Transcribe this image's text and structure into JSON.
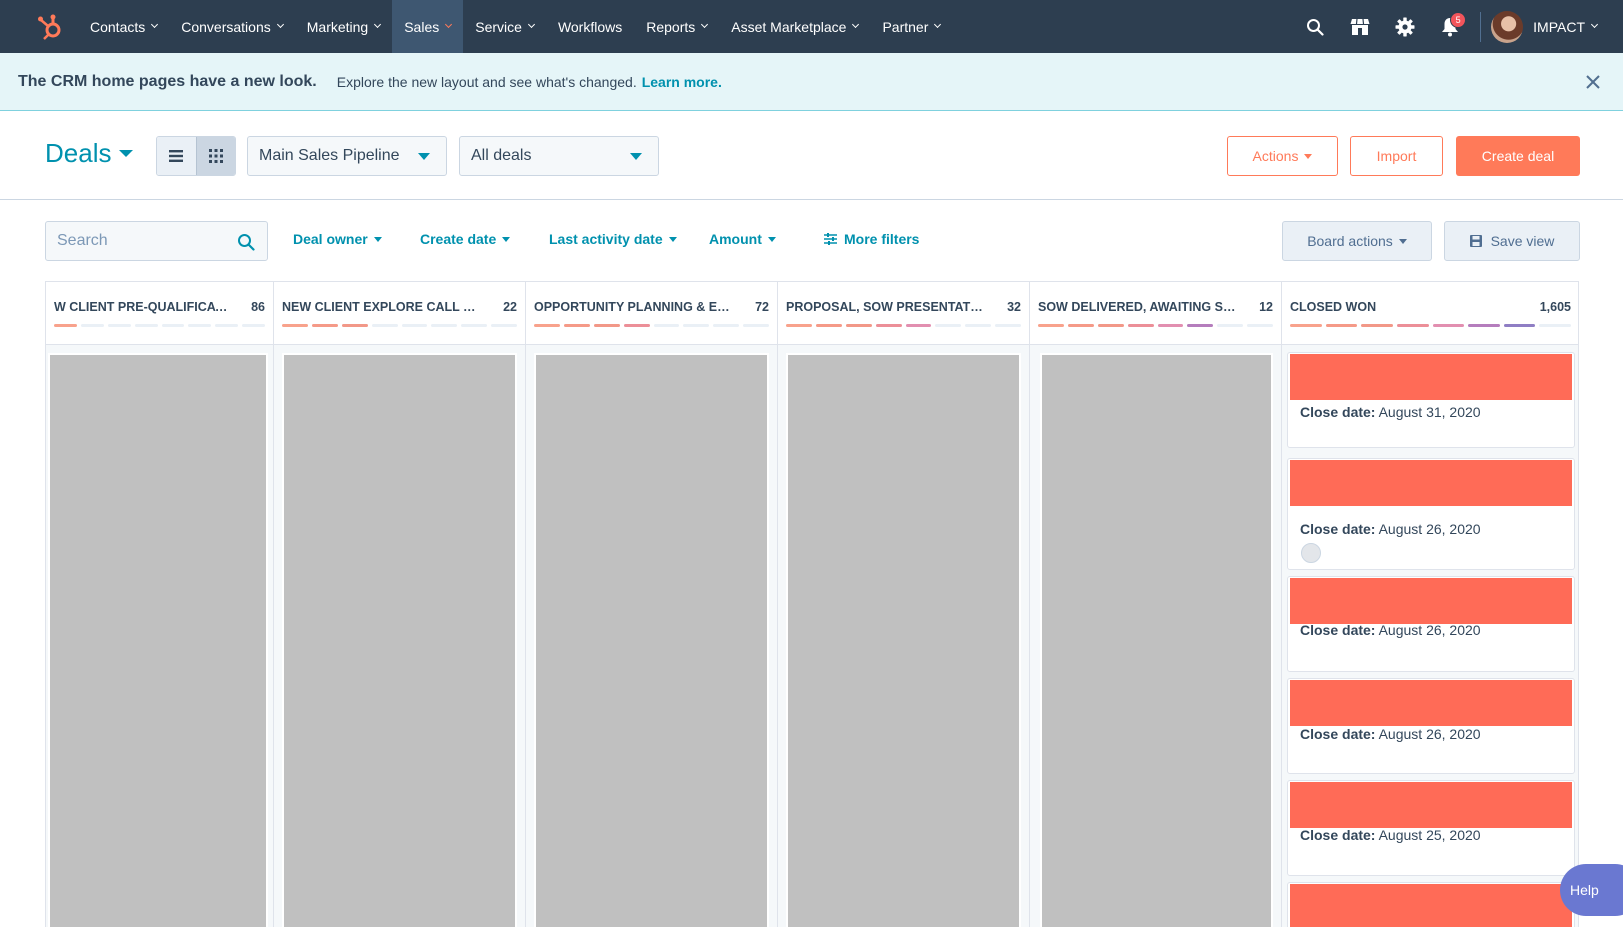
{
  "nav": {
    "items": [
      {
        "label": "Contacts",
        "caret": true,
        "active": false
      },
      {
        "label": "Conversations",
        "caret": true,
        "active": false
      },
      {
        "label": "Marketing",
        "caret": true,
        "active": false
      },
      {
        "label": "Sales",
        "caret": true,
        "active": true
      },
      {
        "label": "Service",
        "caret": true,
        "active": false
      },
      {
        "label": "Workflows",
        "caret": false,
        "active": false
      },
      {
        "label": "Reports",
        "caret": true,
        "active": false
      },
      {
        "label": "Asset Marketplace",
        "caret": true,
        "active": false
      },
      {
        "label": "Partner",
        "caret": true,
        "active": false
      }
    ],
    "notification_count": "5",
    "account_name": "IMPACT"
  },
  "banner": {
    "title": "The CRM home pages have a new look.",
    "text": "Explore the new layout and see what's changed.",
    "link": "Learn more."
  },
  "header": {
    "title": "Deals",
    "pipeline": "Main Sales Pipeline",
    "view": "All deals",
    "actions_label": "Actions",
    "import_label": "Import",
    "create_label": "Create deal"
  },
  "filters": {
    "search_placeholder": "Search",
    "deal_owner": "Deal owner",
    "create_date": "Create date",
    "last_activity": "Last activity date",
    "amount": "Amount",
    "more_filters": "More filters",
    "board_actions": "Board actions",
    "save_view": "Save view"
  },
  "columns": [
    {
      "name": "W CLIENT PRE-QUALIFICATION",
      "count": "86",
      "filled_segments": 1
    },
    {
      "name": "NEW CLIENT EXPLORE CALL SCHEDU...",
      "count": "22",
      "filled_segments": 3
    },
    {
      "name": "OPPORTUNITY PLANNING & EXPECTA...",
      "count": "72",
      "filled_segments": 4
    },
    {
      "name": "PROPOSAL, SOW PRESENTATION SC...",
      "count": "32",
      "filled_segments": 5
    },
    {
      "name": "SOW DELIVERED, AWAITING SIGNAT...",
      "count": "12",
      "filled_segments": 6
    },
    {
      "name": "CLOSED WON",
      "count": "1,605",
      "filled_segments": 7
    }
  ],
  "progress_colors": [
    "#f8a28c",
    "#f59a88",
    "#f29888",
    "#ec8f98",
    "#e28fb0",
    "#b57dbd",
    "#8f7ec4"
  ],
  "closed_won_cards": [
    {
      "label": "Close date:",
      "date": "August 31, 2020",
      "has_avatar": false
    },
    {
      "label": "Close date:",
      "date": "August 26, 2020",
      "has_avatar": true
    },
    {
      "label": "Close date:",
      "date": "August 26, 2020",
      "has_avatar": false
    },
    {
      "label": "Close date:",
      "date": "August 26, 2020",
      "has_avatar": false
    },
    {
      "label": "Close date:",
      "date": "August 25, 2020",
      "has_avatar": false
    }
  ],
  "help_label": "Help",
  "colors": {
    "accent": "#0091ae",
    "brand": "#ff7a59",
    "nav_bg": "#2d3e50"
  }
}
